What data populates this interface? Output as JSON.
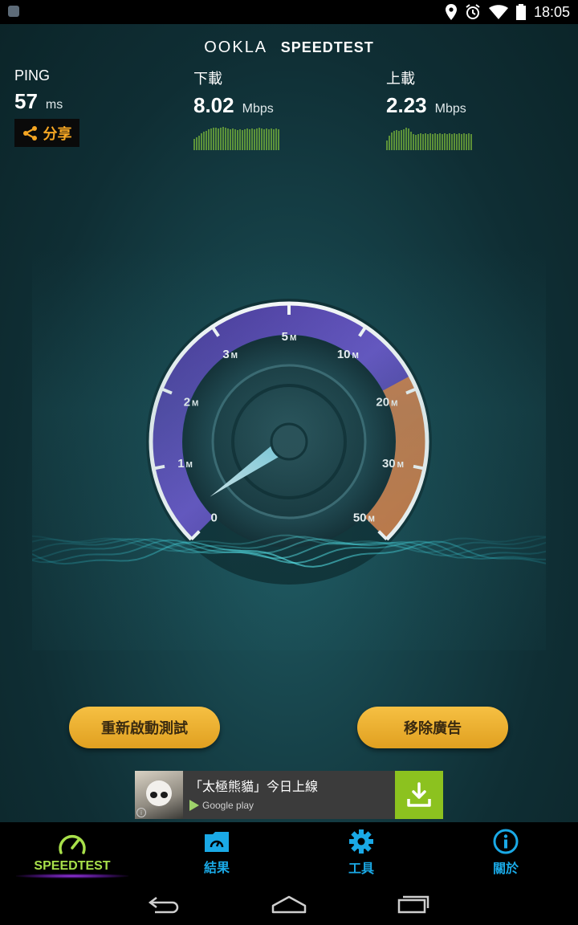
{
  "status_bar": {
    "time": "18:05",
    "icons": [
      "notification-icon",
      "location-icon",
      "alarm-icon",
      "wifi-icon",
      "battery-icon"
    ]
  },
  "header": {
    "logo_part1": "OOKLA",
    "logo_part2": "SPEEDTEST"
  },
  "stats": {
    "ping": {
      "label": "PING",
      "value": "57",
      "unit": "ms"
    },
    "download": {
      "label": "下載",
      "value": "8.02",
      "unit": "Mbps"
    },
    "upload": {
      "label": "上載",
      "value": "2.23",
      "unit": "Mbps"
    }
  },
  "share": {
    "label": "分享",
    "icon": "share-icon"
  },
  "gauge": {
    "ticks": [
      {
        "num": "0",
        "suffix": ""
      },
      {
        "num": "1",
        "suffix": "M"
      },
      {
        "num": "2",
        "suffix": "M"
      },
      {
        "num": "3",
        "suffix": "M"
      },
      {
        "num": "5",
        "suffix": "M"
      },
      {
        "num": "10",
        "suffix": "M"
      },
      {
        "num": "20",
        "suffix": "M"
      },
      {
        "num": "30",
        "suffix": "M"
      },
      {
        "num": "50",
        "suffix": "M"
      }
    ],
    "needle_value_mbps": 0,
    "colors": {
      "arc": "#ffffff",
      "inner_ring": "#7a5fd0",
      "hot_zone": "#e58a3c",
      "needle": "#bfefff"
    }
  },
  "buttons": {
    "restart": "重新啟動測試",
    "remove_ads": "移除廣告"
  },
  "ad": {
    "title": "「太極熊貓」今日上線",
    "store": "Google play",
    "info": "i"
  },
  "tabs": [
    {
      "label": "SPEEDTEST",
      "icon": "speedometer-icon",
      "active": true
    },
    {
      "label": "結果",
      "icon": "folder-gauge-icon",
      "active": false
    },
    {
      "label": "工具",
      "icon": "gear-icon",
      "active": false
    },
    {
      "label": "關於",
      "icon": "info-icon",
      "active": false
    }
  ],
  "nav": [
    "back-icon",
    "home-icon",
    "recents-icon"
  ],
  "colors": {
    "accent_orange": "#f5a623",
    "tab_blue": "#1aa9e6",
    "tab_active_green": "#a8e04a",
    "sparkline_green": "#8fd13a",
    "download_green": "#8cc21f"
  }
}
